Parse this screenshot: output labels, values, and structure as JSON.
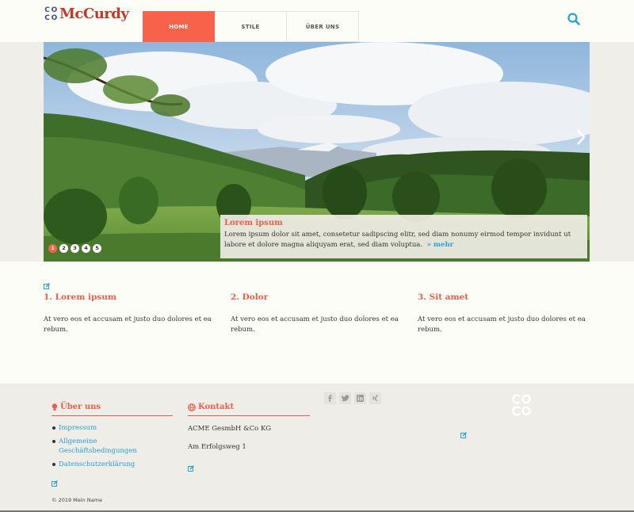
{
  "brand": {
    "logo_letters": [
      "C",
      "O",
      "C",
      "O"
    ],
    "logo_text": "McCurdy",
    "accent_color": "#f7634a",
    "link_color": "#2a9fd6"
  },
  "nav": {
    "items": [
      {
        "label": "HOME",
        "active": true
      },
      {
        "label": "STILE",
        "active": false
      },
      {
        "label": "ÜBER UNS",
        "active": false
      }
    ],
    "search_icon": "search-icon"
  },
  "hero": {
    "caption_title": "Lorem ipsum",
    "caption_text": "Lorem ipsum dolor sit amet, consetetur sadipscing elitr, sed diam nonumy eirmod tempor invidunt ut labore et dolore magna aliquyam erat, sed diam voluptua.",
    "more_label": "mehr",
    "more_icon": "double-chevron-right-icon",
    "next_icon": "chevron-right-icon",
    "slides": [
      "1",
      "2",
      "3",
      "4",
      "5"
    ],
    "active_slide": "1"
  },
  "features": {
    "edit_icon": "edit-icon",
    "items": [
      {
        "title": "1. Lorem ipsum",
        "text": "At vero eos et accusam et justo duo dolores et ea rebum."
      },
      {
        "title": "2. Dolor",
        "text": "At vero eos et accusam et justo duo dolores et ea rebum."
      },
      {
        "title": "3. Sit amet",
        "text": "At vero eos et accusam et justo duo dolores et ea rebum."
      }
    ]
  },
  "footer": {
    "about": {
      "title": "Über uns",
      "icon": "lightbulb-icon",
      "links": [
        "Impressum",
        "Allgemeine Geschäftsbedingungen",
        "Datenschutzerklärung"
      ]
    },
    "contact": {
      "title": "Kontakt",
      "icon": "globe-icon",
      "company": "ACME GesmbH &Co KG",
      "street": "Am Erfolgsweg 1"
    },
    "social": [
      "facebook-icon",
      "twitter-icon",
      "linkedin-icon",
      "xing-icon"
    ],
    "copyright": "© 2019 Mein Name",
    "logo_letters": [
      "C",
      "O",
      "C",
      "O"
    ]
  }
}
